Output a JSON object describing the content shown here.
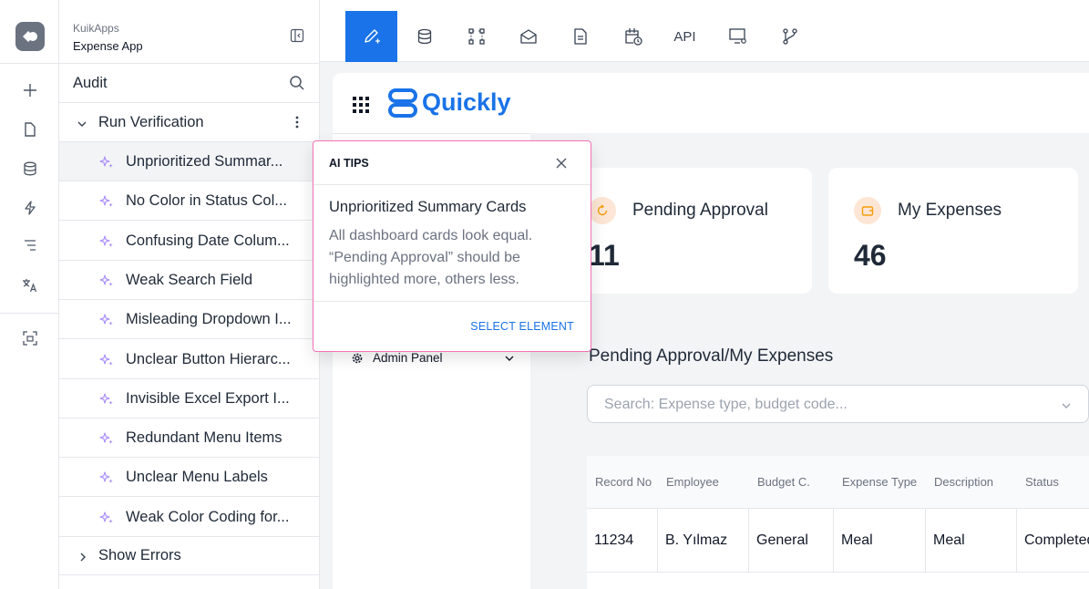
{
  "colors": {
    "accent": "#1a73e8",
    "highlight_border": "#f472b6",
    "sparkle": "#a78bfa",
    "card_icon_bg": "#fde6d5",
    "card_icon": "#f59e0b"
  },
  "rail": {
    "icons": [
      "app-logo-icon",
      "plus-icon",
      "file-icon",
      "database-icon",
      "bolt-icon",
      "list-icon",
      "translate-icon",
      "screenshot-icon"
    ]
  },
  "audit": {
    "brand": "KuikApps",
    "app_name": "Expense App",
    "section_label": "Audit",
    "run_label": "Run Verification",
    "items": [
      {
        "label": "Unprioritized Summar...",
        "selected": true
      },
      {
        "label": "No Color in Status Col..."
      },
      {
        "label": "Confusing Date Colum..."
      },
      {
        "label": "Weak Search Field"
      },
      {
        "label": "Misleading Dropdown I..."
      },
      {
        "label": "Unclear Button Hierarc..."
      },
      {
        "label": "Invisible Excel Export I..."
      },
      {
        "label": "Redundant Menu Items"
      },
      {
        "label": "Unclear Menu Labels"
      },
      {
        "label": "Weak Color Coding for..."
      }
    ],
    "show_errors_label": "Show Errors"
  },
  "toolbar": {
    "items": [
      "pen-plus-icon",
      "database-icon",
      "workflow-icon",
      "mail-icon",
      "document-icon",
      "calendar-clock-icon",
      "API",
      "monitor-settings-icon",
      "git-branch-icon"
    ],
    "api_label": "API"
  },
  "preview": {
    "brand": "Quickly",
    "menu_admin": "Admin Panel",
    "cards": [
      {
        "title": "Pending Approval",
        "value": "11"
      },
      {
        "title": "My Expenses",
        "value": "46"
      }
    ],
    "section_title": "Pending Approval/My Expenses",
    "search_placeholder": "Search: Expense type, budget code...",
    "table": {
      "headers": [
        "Record No",
        "Employee",
        "Budget C.",
        "Expense Type",
        "Description",
        "Status"
      ],
      "rows": [
        [
          "11234",
          "B. Yılmaz",
          "General",
          "Meal",
          "Meal",
          "Completed"
        ]
      ]
    }
  },
  "tips": {
    "title": "AI TIPS",
    "heading": "Unprioritized Summary Cards",
    "body": "All dashboard cards look equal. “Pending Approval” should be highlighted more, others less.",
    "action": "SELECT ELEMENT"
  }
}
